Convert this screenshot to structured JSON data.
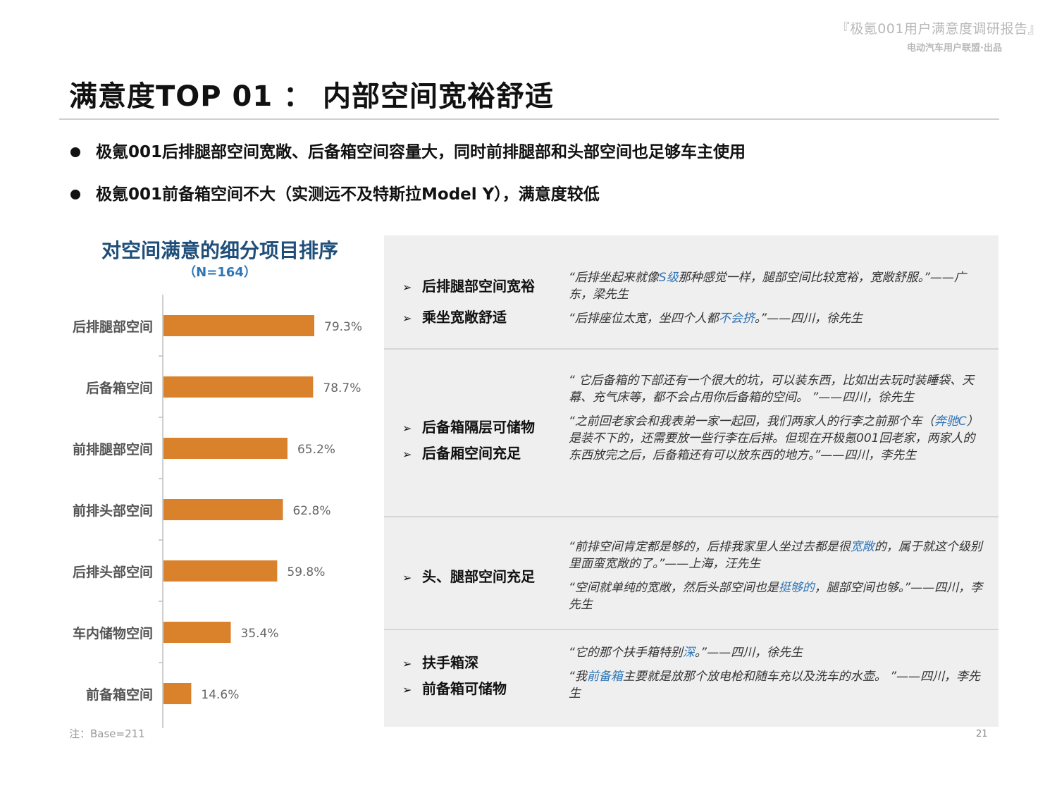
{
  "header": {
    "report_title": "『极氪001用户满意度调研报告』",
    "publisher": "电动汽车用户联盟·出品"
  },
  "page_title": "满意度TOP 01 ：  内部空间宽裕舒适",
  "bullets": [
    "极氪001后排腿部空间宽敞、后备箱空间容量大，同时前排腿部和头部空间也足够车主使用",
    "极氪001前备箱空间不大（实测远不及特斯拉Model Y），满意度较低"
  ],
  "chart_data": {
    "type": "bar",
    "orientation": "horizontal",
    "title": "对空间满意的细分项目排序",
    "subtitle": "（N=164）",
    "categories": [
      "后排腿部空间",
      "后备箱空间",
      "前排腿部空间",
      "前排头部空间",
      "后排头部空间",
      "车内储物空间",
      "前备箱空间"
    ],
    "values": [
      79.3,
      78.7,
      65.2,
      62.8,
      59.8,
      35.4,
      14.6
    ],
    "value_labels": [
      "79.3%",
      "78.7%",
      "65.2%",
      "62.8%",
      "59.8%",
      "35.4%",
      "14.6%"
    ],
    "unit": "%",
    "bar_color": "#d9822b",
    "grid": false,
    "legend": "none"
  },
  "note": "注：Base=211",
  "page_number": "21",
  "colors": {
    "accent_blue": "#2e75b6",
    "title_blue": "#1f4e79",
    "bar_orange": "#d9822b"
  },
  "feedback": [
    {
      "tags": [
        "后排腿部空间宽裕",
        "乘坐宽敞舒适"
      ],
      "quotes": [
        [
          {
            "t": "“后排坐起来就像"
          },
          {
            "t": "S级",
            "hl": true
          },
          {
            "t": "那种感觉一样，腿部空间比较宽裕，宽敞舒服。”——广东，梁先生"
          }
        ],
        [
          {
            "t": "“后排座位太宽，坐四个人都"
          },
          {
            "t": "不会挤",
            "hl": true
          },
          {
            "t": "。”——四川，徐先生"
          }
        ]
      ]
    },
    {
      "tags": [
        "后备箱隔层可储物",
        "后备厢空间充足"
      ],
      "quotes": [
        [
          {
            "t": "“ 它后备箱的下部还有一个很大的坑，可以装东西，比如出去玩时装睡袋、天幕、充气床等，都不会占用你后备箱的空间。 ”——四川，徐先生"
          }
        ],
        [
          {
            "t": "“之前回老家会和我表弟一家一起回，我们两家人的行李之前那个车（"
          },
          {
            "t": "奔驰C",
            "hl": true
          },
          {
            "t": "）是装不下的，还需要放一些行李在后排。但现在开极氪001回老家，两家人的东西放完之后，后备箱还有可以放东西的地方。”——四川，李先生"
          }
        ]
      ]
    },
    {
      "tags": [
        "头、腿部空间充足"
      ],
      "quotes": [
        [
          {
            "t": "“前排空间肯定都是够的，后排我家里人坐过去都是很"
          },
          {
            "t": "宽敞",
            "hl": true
          },
          {
            "t": "的，属于就这个级别里面蛮宽敞的了。”——上海，汪先生"
          }
        ],
        [
          {
            "t": "“空间就单纯的宽敞，然后头部空间也是"
          },
          {
            "t": "挺够的",
            "hl": true
          },
          {
            "t": "，腿部空间也够。”——四川，李先生"
          }
        ]
      ]
    },
    {
      "tags": [
        "扶手箱深",
        "前备箱可储物"
      ],
      "quotes": [
        [
          {
            "t": "“它的那个扶手箱特别"
          },
          {
            "t": "深",
            "hl": true
          },
          {
            "t": "。”——四川，徐先生"
          }
        ],
        [
          {
            "t": "“我"
          },
          {
            "t": "前备箱",
            "hl": true
          },
          {
            "t": "主要就是放那个放电枪和随车充以及洗车的水壶。 ”——四川，李先生"
          }
        ]
      ]
    }
  ]
}
